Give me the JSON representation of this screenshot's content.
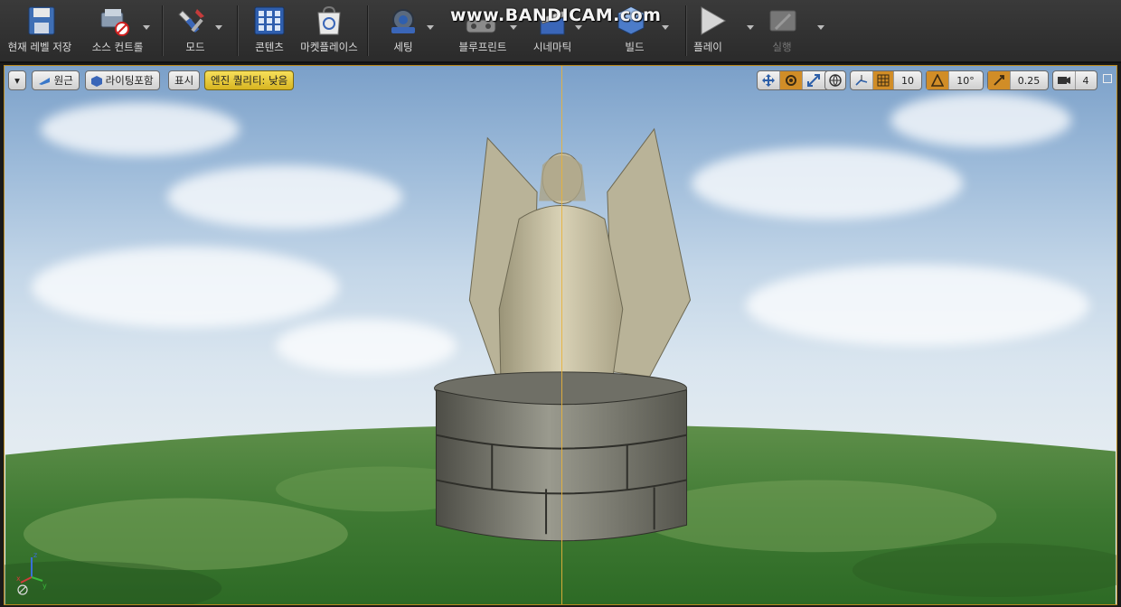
{
  "toolbar": {
    "items": [
      {
        "label": "현재 레벨 저장",
        "icon": "save-icon"
      },
      {
        "label": "소스 컨트롤",
        "icon": "source-control-icon"
      },
      {
        "label": "모드",
        "icon": "modes-icon"
      },
      {
        "label": "콘텐츠",
        "icon": "content-icon"
      },
      {
        "label": "마켓플레이스",
        "icon": "marketplace-icon"
      },
      {
        "label": "세팅",
        "icon": "settings-icon"
      },
      {
        "label": "블루프린트",
        "icon": "blueprints-icon"
      },
      {
        "label": "시네마틱",
        "icon": "cinematics-icon"
      },
      {
        "label": "빌드",
        "icon": "build-icon"
      },
      {
        "label": "플레이",
        "icon": "play-icon"
      },
      {
        "label": "실행",
        "icon": "launch-icon"
      }
    ]
  },
  "watermark": "www.BANDICAM.com",
  "viewport": {
    "menu_label": "▾",
    "perspective_label": "원근",
    "lighting_label": "라이팅포함",
    "show_label": "표시",
    "quality_label": "엔진 퀄리티: 낮음",
    "grid_snap_value": "10",
    "rotate_snap_value": "10°",
    "scale_snap_value": "0.25",
    "camera_speed_value": "4"
  },
  "colors": {
    "accent": "#d18d27",
    "warning": "#e8c83a",
    "selection": "#e8b23a"
  }
}
